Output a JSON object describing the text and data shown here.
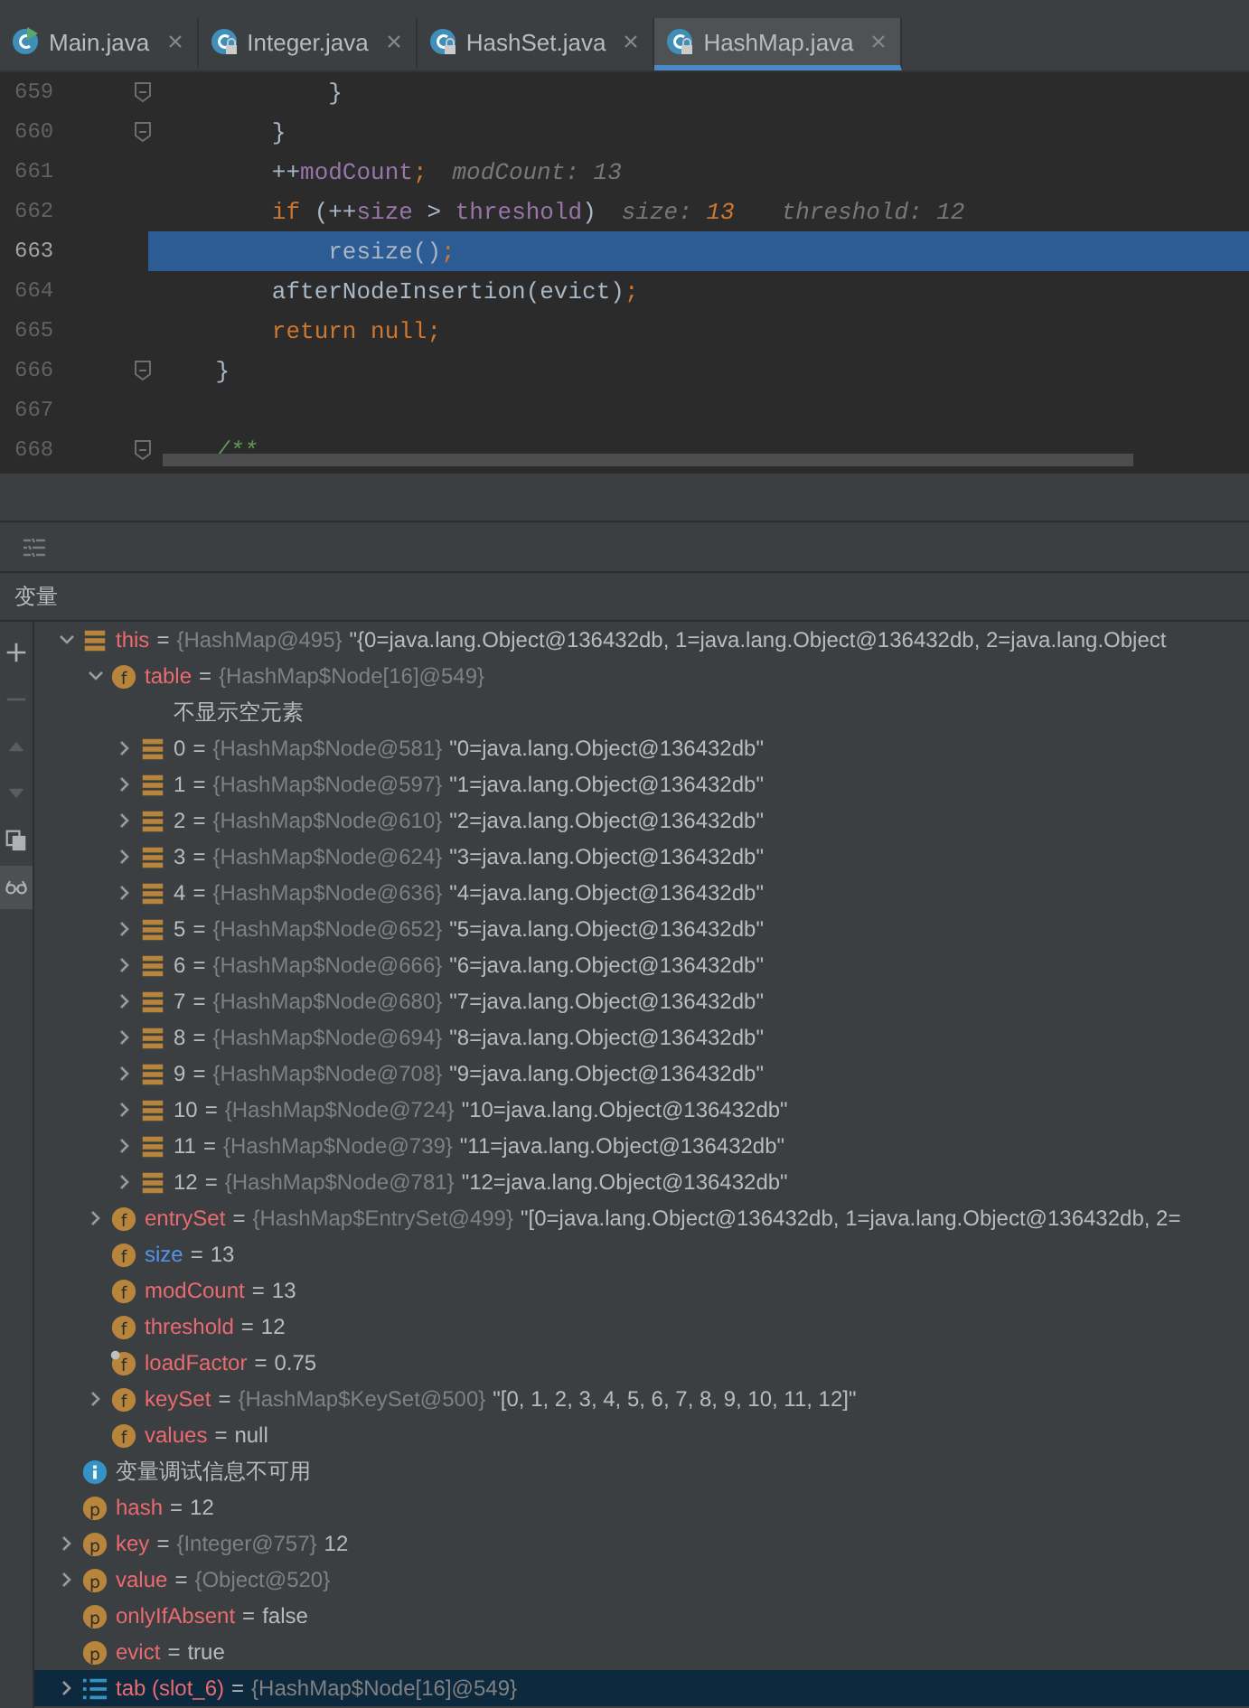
{
  "tabs": [
    {
      "label": "Main.java",
      "kind": "runnable",
      "selected": false
    },
    {
      "label": "Integer.java",
      "kind": "readonly",
      "selected": false
    },
    {
      "label": "HashSet.java",
      "kind": "readonly",
      "selected": false
    },
    {
      "label": "HashMap.java",
      "kind": "readonly",
      "selected": true
    }
  ],
  "code": [
    {
      "number": "659",
      "fold": true,
      "current": false,
      "tokens": [
        {
          "text": "            }",
          "kind": "plain"
        }
      ]
    },
    {
      "number": "660",
      "fold": true,
      "current": false,
      "tokens": [
        {
          "text": "        }",
          "kind": "plain"
        }
      ]
    },
    {
      "number": "661",
      "fold": false,
      "current": false,
      "tokens": [
        {
          "text": "        ++",
          "kind": "plain"
        },
        {
          "text": "modCount",
          "kind": "field"
        },
        {
          "text": ";",
          "kind": "keyword"
        },
        {
          "text": "modCount: 13",
          "kind": "hint"
        }
      ]
    },
    {
      "number": "662",
      "fold": false,
      "current": false,
      "tokens": [
        {
          "text": "        if",
          "kind": "keyword"
        },
        {
          "text": " (++",
          "kind": "plain"
        },
        {
          "text": "size",
          "kind": "field"
        },
        {
          "text": " > ",
          "kind": "plain"
        },
        {
          "text": "threshold",
          "kind": "field"
        },
        {
          "text": ")",
          "kind": "plain"
        },
        {
          "text": "size: ",
          "kind": "hint"
        },
        {
          "text": "13",
          "kind": "hint-number"
        },
        {
          "text": "threshold: 12",
          "kind": "hint"
        }
      ]
    },
    {
      "number": "663",
      "fold": false,
      "current": true,
      "tokens": [
        {
          "text": "            resize()",
          "kind": "plain"
        },
        {
          "text": ";",
          "kind": "keyword"
        }
      ]
    },
    {
      "number": "664",
      "fold": false,
      "current": false,
      "tokens": [
        {
          "text": "        afterNodeInsertion(evict)",
          "kind": "plain"
        },
        {
          "text": ";",
          "kind": "keyword"
        }
      ]
    },
    {
      "number": "665",
      "fold": false,
      "current": false,
      "tokens": [
        {
          "text": "        return null;",
          "kind": "keyword"
        }
      ]
    },
    {
      "number": "666",
      "fold": true,
      "current": false,
      "tokens": [
        {
          "text": "    }",
          "kind": "plain"
        }
      ]
    },
    {
      "number": "667",
      "fold": false,
      "current": false
    },
    {
      "number": "668",
      "fold": true,
      "current": false,
      "tokens": [
        {
          "text": "    /**",
          "kind": "comment"
        }
      ]
    }
  ],
  "debugger": {
    "title": "变量",
    "tools": [
      {
        "kind": "add",
        "disabled": false
      },
      {
        "kind": "remove",
        "disabled": true
      },
      {
        "kind": "up",
        "disabled": true
      },
      {
        "kind": "down",
        "disabled": true
      },
      {
        "kind": "copy",
        "disabled": false
      },
      {
        "kind": "watch",
        "disabled": false,
        "selected": true
      }
    ],
    "tree": [
      {
        "kind": "object",
        "name": "this",
        "eq": "=",
        "type": "{HashMap@495}",
        "value": "\"{0=java.lang.Object@136432db, 1=java.lang.Object@136432db, 2=java.lang.Object",
        "expanded": true,
        "children": [
          {
            "kind": "field",
            "badge": "f",
            "name": "table",
            "eq": "=",
            "type": "{HashMap$Node[16]@549}",
            "expanded": true,
            "children": [
              {
                "kind": "note",
                "name": "不显示空元素"
              },
              {
                "kind": "element",
                "name": "0",
                "eq": "=",
                "type": "{HashMap$Node@581}",
                "value": "\"0=java.lang.Object@136432db\"",
                "expanded": false
              },
              {
                "kind": "element",
                "name": "1",
                "eq": "=",
                "type": "{HashMap$Node@597}",
                "value": "\"1=java.lang.Object@136432db\"",
                "expanded": false
              },
              {
                "kind": "element",
                "name": "2",
                "eq": "=",
                "type": "{HashMap$Node@610}",
                "value": "\"2=java.lang.Object@136432db\"",
                "expanded": false
              },
              {
                "kind": "element",
                "name": "3",
                "eq": "=",
                "type": "{HashMap$Node@624}",
                "value": "\"3=java.lang.Object@136432db\"",
                "expanded": false
              },
              {
                "kind": "element",
                "name": "4",
                "eq": "=",
                "type": "{HashMap$Node@636}",
                "value": "\"4=java.lang.Object@136432db\"",
                "expanded": false
              },
              {
                "kind": "element",
                "name": "5",
                "eq": "=",
                "type": "{HashMap$Node@652}",
                "value": "\"5=java.lang.Object@136432db\"",
                "expanded": false
              },
              {
                "kind": "element",
                "name": "6",
                "eq": "=",
                "type": "{HashMap$Node@666}",
                "value": "\"6=java.lang.Object@136432db\"",
                "expanded": false
              },
              {
                "kind": "element",
                "name": "7",
                "eq": "=",
                "type": "{HashMap$Node@680}",
                "value": "\"7=java.lang.Object@136432db\"",
                "expanded": false
              },
              {
                "kind": "element",
                "name": "8",
                "eq": "=",
                "type": "{HashMap$Node@694}",
                "value": "\"8=java.lang.Object@136432db\"",
                "expanded": false
              },
              {
                "kind": "element",
                "name": "9",
                "eq": "=",
                "type": "{HashMap$Node@708}",
                "value": "\"9=java.lang.Object@136432db\"",
                "expanded": false
              },
              {
                "kind": "element",
                "name": "10",
                "eq": "=",
                "type": "{HashMap$Node@724}",
                "value": "\"10=java.lang.Object@136432db\"",
                "expanded": false
              },
              {
                "kind": "element",
                "name": "11",
                "eq": "=",
                "type": "{HashMap$Node@739}",
                "value": "\"11=java.lang.Object@136432db\"",
                "expanded": false
              },
              {
                "kind": "element",
                "name": "12",
                "eq": "=",
                "type": "{HashMap$Node@781}",
                "value": "\"12=java.lang.Object@136432db\"",
                "expanded": false
              }
            ]
          },
          {
            "kind": "field",
            "badge": "f",
            "name": "entrySet",
            "eq": "=",
            "type": "{HashMap$EntrySet@499}",
            "value": "\"[0=java.lang.Object@136432db, 1=java.lang.Object@136432db, 2=",
            "expanded": false
          },
          {
            "kind": "field",
            "badge": "f",
            "name": "size",
            "eq": "=",
            "value": "13",
            "changed": true
          },
          {
            "kind": "field",
            "badge": "f",
            "name": "modCount",
            "eq": "=",
            "value": "13"
          },
          {
            "kind": "field",
            "badge": "f",
            "name": "threshold",
            "eq": "=",
            "value": "12"
          },
          {
            "kind": "final-field",
            "badge": "f",
            "name": "loadFactor",
            "eq": "=",
            "value": "0.75"
          },
          {
            "kind": "field",
            "badge": "f",
            "name": "keySet",
            "eq": "=",
            "type": "{HashMap$KeySet@500}",
            "value": "\"[0, 1, 2, 3, 4, 5, 6, 7, 8, 9, 10, 11, 12]\"",
            "expanded": false
          },
          {
            "kind": "field",
            "badge": "f",
            "name": "values",
            "eq": "=",
            "value": "null"
          }
        ]
      },
      {
        "kind": "info",
        "name": "变量调试信息不可用"
      },
      {
        "kind": "param",
        "badge": "p",
        "name": "hash",
        "eq": "=",
        "value": "12"
      },
      {
        "kind": "param",
        "badge": "p",
        "name": "key",
        "eq": "=",
        "type": "{Integer@757}",
        "value": "12",
        "expanded": false
      },
      {
        "kind": "param",
        "badge": "p",
        "name": "value",
        "eq": "=",
        "type": "{Object@520}",
        "expanded": false
      },
      {
        "kind": "param",
        "badge": "p",
        "name": "onlyIfAbsent",
        "eq": "=",
        "value": "false"
      },
      {
        "kind": "param",
        "badge": "p",
        "name": "evict",
        "eq": "=",
        "value": "true"
      },
      {
        "kind": "local",
        "name": "tab (slot_6)",
        "eq": "=",
        "type": "{HashMap$Node[16]@549}",
        "expanded": false,
        "selected": true
      }
    ]
  }
}
